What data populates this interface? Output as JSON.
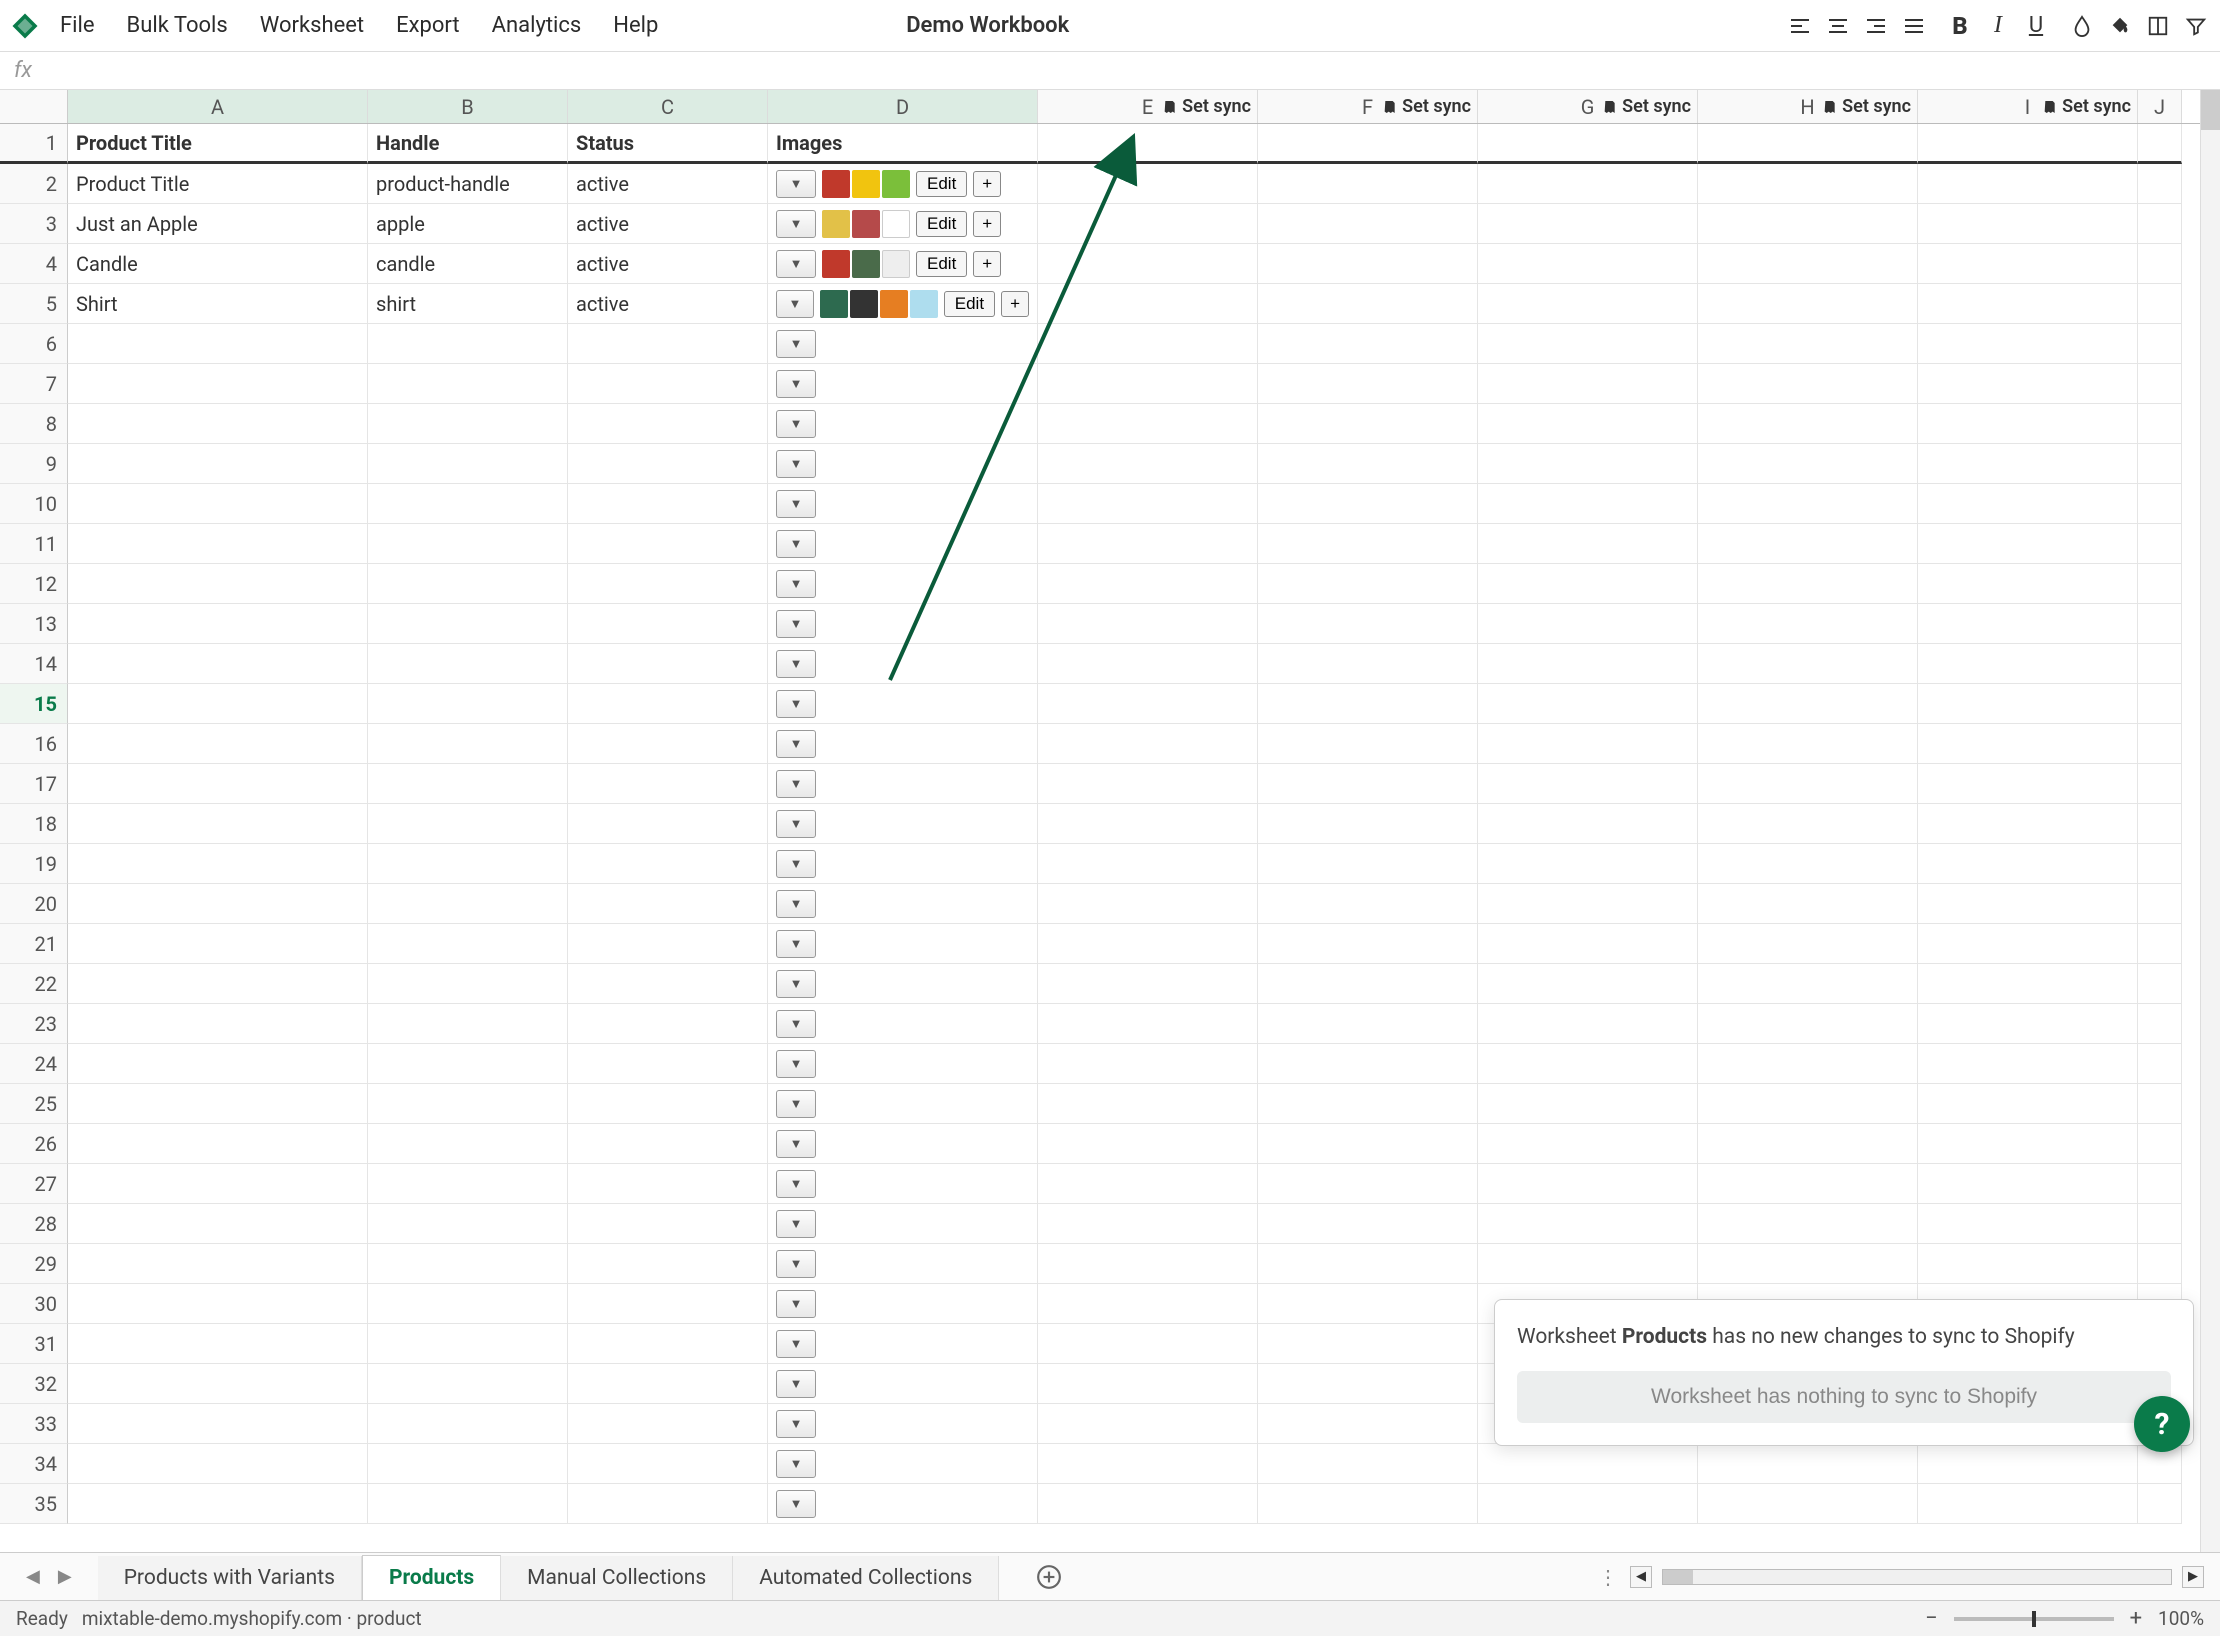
{
  "menu": {
    "items": [
      "File",
      "Bulk Tools",
      "Worksheet",
      "Export",
      "Analytics",
      "Help"
    ],
    "workbook_title": "Demo Workbook"
  },
  "formula_bar": {
    "fx_label": "fx"
  },
  "columns": [
    {
      "letter": "A",
      "sync": false,
      "active": true,
      "wclass": "w-a"
    },
    {
      "letter": "B",
      "sync": false,
      "active": true,
      "wclass": "w-b"
    },
    {
      "letter": "C",
      "sync": false,
      "active": true,
      "wclass": "w-c"
    },
    {
      "letter": "D",
      "sync": false,
      "active": true,
      "wclass": "w-d"
    },
    {
      "letter": "E",
      "sync": true,
      "active": false,
      "wclass": "w-e"
    },
    {
      "letter": "F",
      "sync": true,
      "active": false,
      "wclass": "w-f"
    },
    {
      "letter": "G",
      "sync": true,
      "active": false,
      "wclass": "w-g"
    },
    {
      "letter": "H",
      "sync": true,
      "active": false,
      "wclass": "w-h"
    },
    {
      "letter": "I",
      "sync": true,
      "active": false,
      "wclass": "w-i"
    },
    {
      "letter": "J",
      "sync": false,
      "active": false,
      "wclass": "w-j"
    }
  ],
  "sync_label": "Set sync",
  "header_row": {
    "cells": [
      "Product Title",
      "Handle",
      "Status",
      "Images"
    ]
  },
  "data_rows": [
    {
      "n": 2,
      "title": "Product Title",
      "handle": "product-handle",
      "status": "active",
      "images": [
        "#c0392b",
        "#f1c40f",
        "#7bbf3a"
      ]
    },
    {
      "n": 3,
      "title": "Just an Apple",
      "handle": "apple",
      "status": "active",
      "images": [
        "#e2c148",
        "#b54a4a",
        "#ffffff"
      ]
    },
    {
      "n": 4,
      "title": "Candle",
      "handle": "candle",
      "status": "active",
      "images": [
        "#c0392b",
        "#4a6b4a",
        "#eeeeee"
      ]
    },
    {
      "n": 5,
      "title": "Shirt",
      "handle": "shirt",
      "status": "active",
      "images": [
        "#2d6a4f",
        "#333333",
        "#e67e22",
        "#aeddee"
      ]
    }
  ],
  "edit_label": "Edit",
  "plus_label": "+",
  "empty_rows_start": 6,
  "empty_rows_end": 35,
  "active_empty_row": 15,
  "sync_popup": {
    "prefix": "Worksheet ",
    "bold": "Products",
    "suffix": " has no new changes to sync to Shopify",
    "button": "Worksheet has nothing to sync to Shopify"
  },
  "help_label": "?",
  "sheet_tabs": [
    {
      "label": "Products with Variants",
      "active": false
    },
    {
      "label": "Products",
      "active": true
    },
    {
      "label": "Manual Collections",
      "active": false
    },
    {
      "label": "Automated Collections",
      "active": false
    }
  ],
  "status": {
    "ready": "Ready",
    "store": "mixtable-demo.myshopify.com · product",
    "zoom": "100%"
  }
}
